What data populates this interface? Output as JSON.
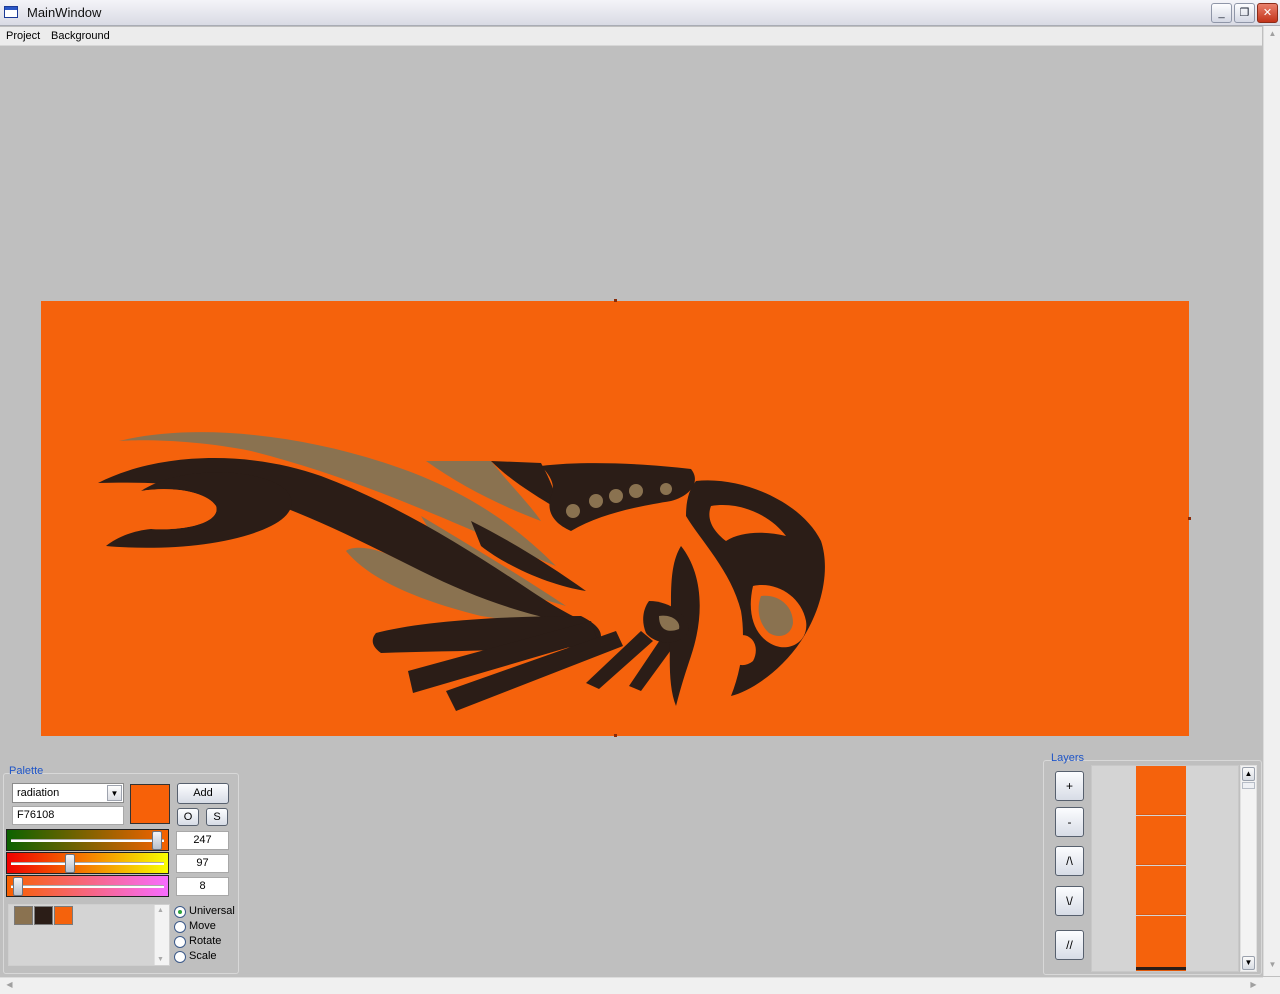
{
  "window": {
    "title": "MainWindow"
  },
  "menu": {
    "project": "Project",
    "background": "Background"
  },
  "palette": {
    "title": "Palette",
    "scheme": "radiation",
    "hex": "F76108",
    "current_color": "#F76108",
    "add_label": "Add",
    "o_label": "O",
    "s_label": "S",
    "red": "247",
    "green": "97",
    "blue": "8",
    "red_value": 247,
    "green_value": 97,
    "blue_value": 8,
    "swatches": [
      "#8a7250",
      "#2b1d17",
      "#f5620c"
    ],
    "modes": [
      "Universal",
      "Move",
      "Rotate",
      "Scale"
    ],
    "selected_mode": "Universal"
  },
  "layers": {
    "title": "Layers",
    "buttons": [
      "+",
      "-",
      "/\\",
      "\\/",
      "//"
    ]
  },
  "colors": {
    "background": "#f5620c",
    "dark": "#2b1d17",
    "tan": "#8a7250"
  }
}
